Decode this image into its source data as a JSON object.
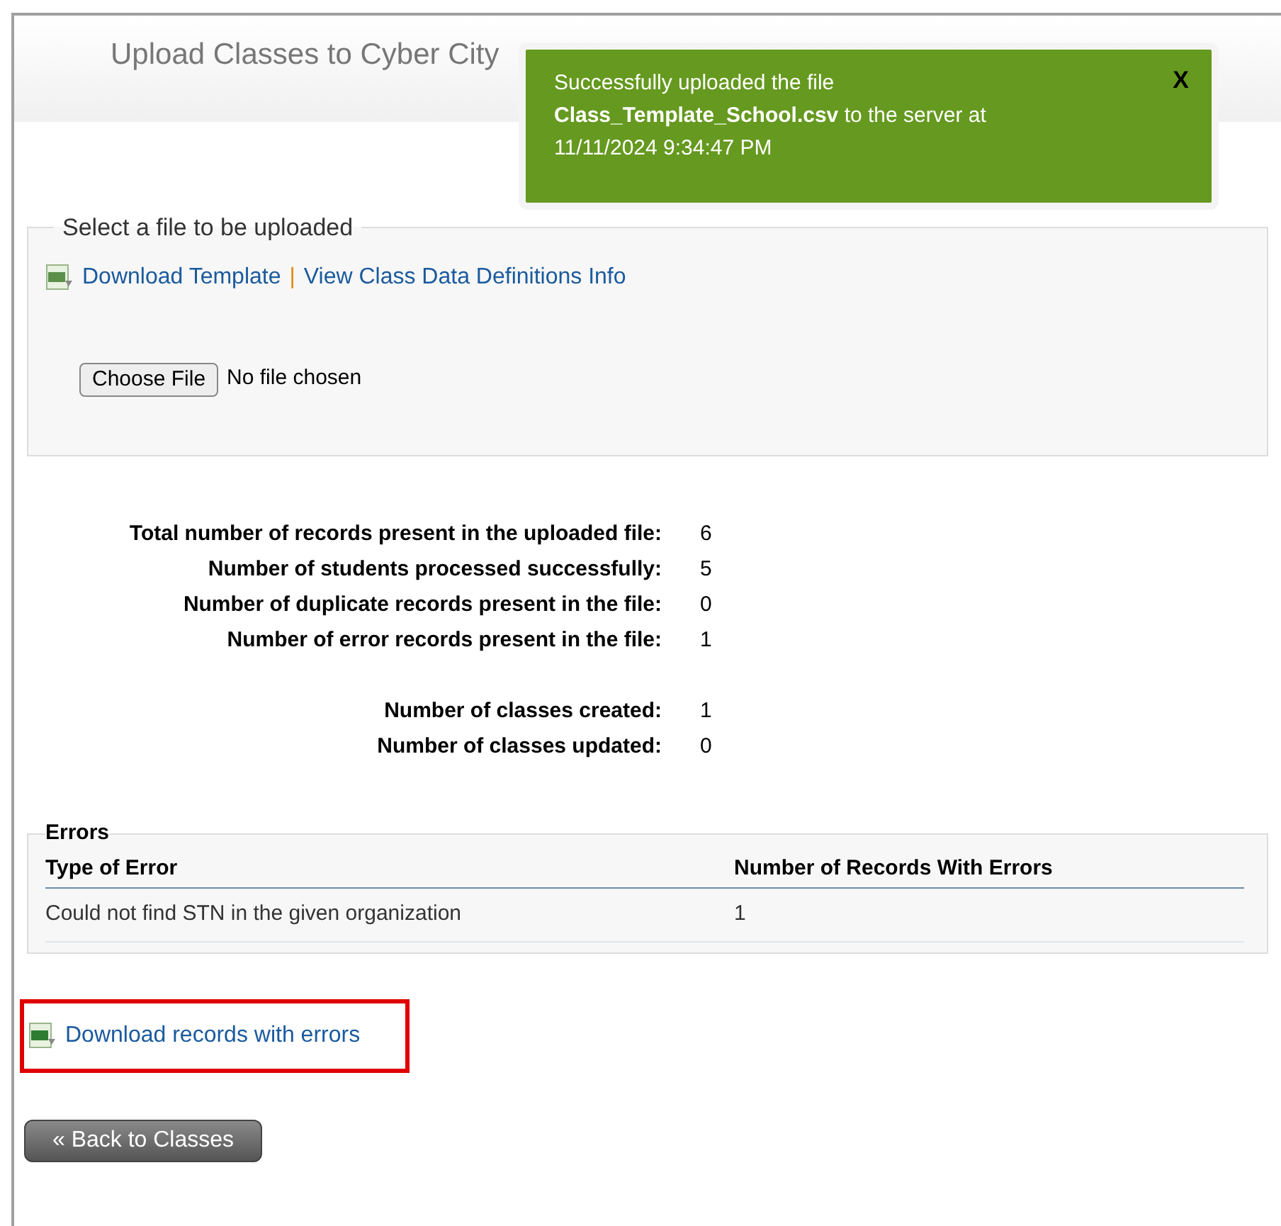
{
  "page_title": "Upload Classes to Cyber City",
  "toast": {
    "message": "Successfully uploaded the file **Class_Template_School.csv** to the server at 11/11/2024 9:34:47 PM",
    "close": "X"
  },
  "upload": {
    "legend": "Select a file to be uploaded",
    "links": [
      "Download Template",
      "View Class Data Definitions Info"
    ],
    "separator": "|",
    "file_button": "Choose File",
    "file_status": "No file chosen"
  },
  "stats": [
    {
      "label": "Total number of records present in the uploaded file:",
      "value": "6"
    },
    {
      "label": "Number of students processed successfully:",
      "value": "5"
    },
    {
      "label": "Number of duplicate records present in the file:",
      "value": "0"
    },
    {
      "label": "Number of error records present in the file:",
      "value": "1"
    }
  ],
  "class_stats": [
    {
      "label": "Number of classes created:",
      "value": "1"
    },
    {
      "label": "Number of classes updated:",
      "value": "0"
    }
  ],
  "errors": {
    "legend": "Errors",
    "columns": [
      "Type of Error",
      "Number of Records With Errors"
    ],
    "rows": [
      [
        "Could not find STN in the given organization",
        "1"
      ]
    ]
  },
  "download_errors": "Download records with errors",
  "back_button": "« Back to Classes"
}
